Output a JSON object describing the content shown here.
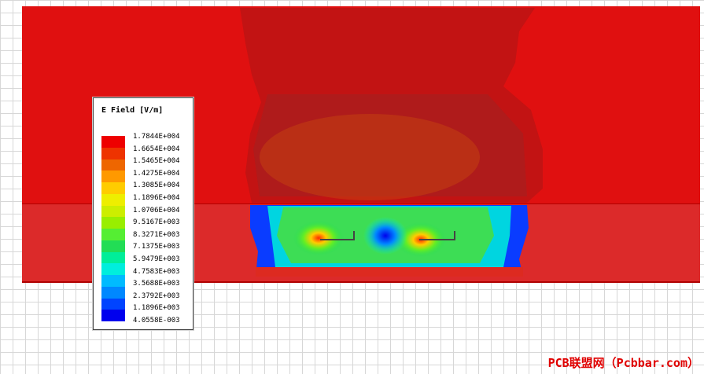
{
  "legend": {
    "title": "E Field [V/m]",
    "values": [
      "1.7844E+004",
      "1.6654E+004",
      "1.5465E+004",
      "1.4275E+004",
      "1.3085E+004",
      "1.1896E+004",
      "1.0706E+004",
      "9.5167E+003",
      "8.3271E+003",
      "7.1375E+003",
      "5.9479E+003",
      "4.7583E+003",
      "3.5688E+003",
      "2.3792E+003",
      "1.1896E+003",
      "4.0558E-003"
    ],
    "colors": [
      "#ee0000",
      "#ee3300",
      "#ee6600",
      "#ff9900",
      "#ffcc00",
      "#eeee00",
      "#ccee00",
      "#99ee00",
      "#55ee33",
      "#22dd55",
      "#00ee99",
      "#00eedd",
      "#00bbff",
      "#0088ff",
      "#0044ff",
      "#0000ee"
    ]
  },
  "watermark": "PCB联盟网（Pcbbar.com）"
}
